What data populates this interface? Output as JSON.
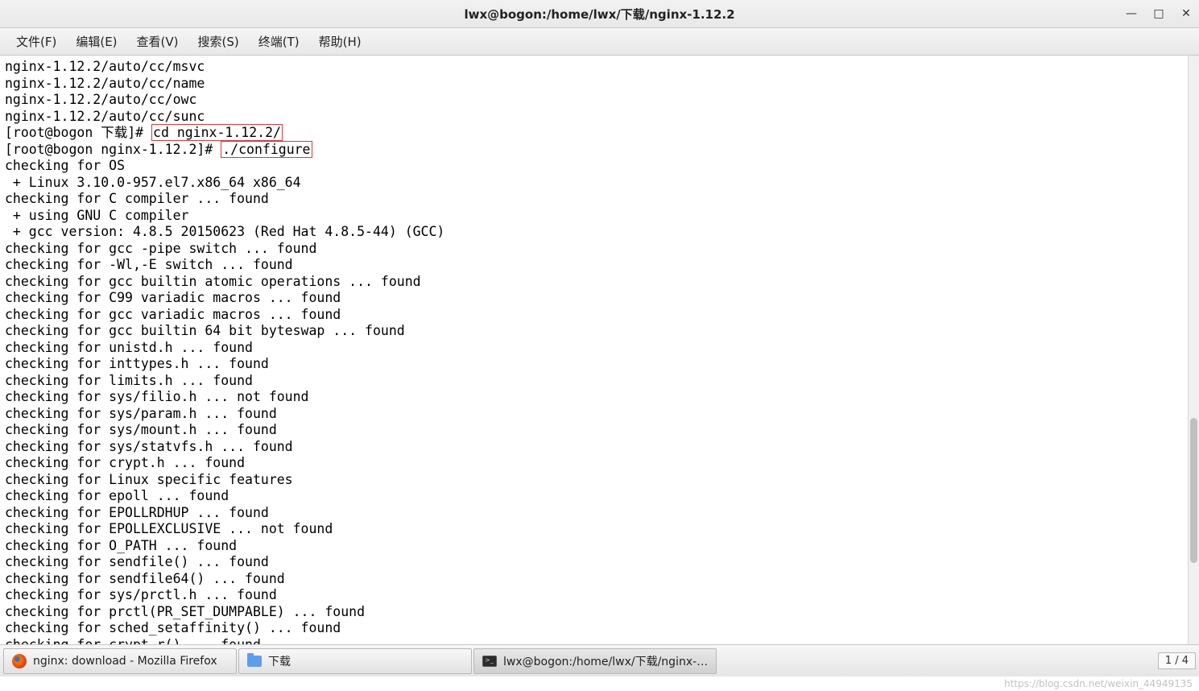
{
  "window": {
    "title": "lwx@bogon:/home/lwx/下载/nginx-1.12.2"
  },
  "menu": {
    "file": "文件(F)",
    "edit": "编辑(E)",
    "view": "查看(V)",
    "search": "搜索(S)",
    "terminal": "终端(T)",
    "help": "帮助(H)"
  },
  "terminal": {
    "l1": "nginx-1.12.2/auto/cc/msvc",
    "l2": "nginx-1.12.2/auto/cc/name",
    "l3": "nginx-1.12.2/auto/cc/owc",
    "l4": "nginx-1.12.2/auto/cc/sunc",
    "prompt1_pre": "[root@bogon 下载]# ",
    "prompt1_cmd": "cd nginx-1.12.2/",
    "prompt2_pre": "[root@bogon nginx-1.12.2]# ",
    "prompt2_cmd": "./configure",
    "l7": "checking for OS",
    "l8": " + Linux 3.10.0-957.el7.x86_64 x86_64",
    "l9": "checking for C compiler ... found",
    "l10": " + using GNU C compiler",
    "l11": " + gcc version: 4.8.5 20150623 (Red Hat 4.8.5-44) (GCC)",
    "l12": "checking for gcc -pipe switch ... found",
    "l13": "checking for -Wl,-E switch ... found",
    "l14": "checking for gcc builtin atomic operations ... found",
    "l15": "checking for C99 variadic macros ... found",
    "l16": "checking for gcc variadic macros ... found",
    "l17": "checking for gcc builtin 64 bit byteswap ... found",
    "l18": "checking for unistd.h ... found",
    "l19": "checking for inttypes.h ... found",
    "l20": "checking for limits.h ... found",
    "l21": "checking for sys/filio.h ... not found",
    "l22": "checking for sys/param.h ... found",
    "l23": "checking for sys/mount.h ... found",
    "l24": "checking for sys/statvfs.h ... found",
    "l25": "checking for crypt.h ... found",
    "l26": "checking for Linux specific features",
    "l27": "checking for epoll ... found",
    "l28": "checking for EPOLLRDHUP ... found",
    "l29": "checking for EPOLLEXCLUSIVE ... not found",
    "l30": "checking for O_PATH ... found",
    "l31": "checking for sendfile() ... found",
    "l32": "checking for sendfile64() ... found",
    "l33": "checking for sys/prctl.h ... found",
    "l34": "checking for prctl(PR_SET_DUMPABLE) ... found",
    "l35": "checking for sched_setaffinity() ... found",
    "l36": "checking for crypt_r() ... found"
  },
  "taskbar": {
    "item1": "nginx: download - Mozilla Firefox",
    "item2": "下载",
    "item3": "lwx@bogon:/home/lwx/下载/nginx-…"
  },
  "workspace": "1 / 4",
  "watermark": "https://blog.csdn.net/weixin_44949135"
}
